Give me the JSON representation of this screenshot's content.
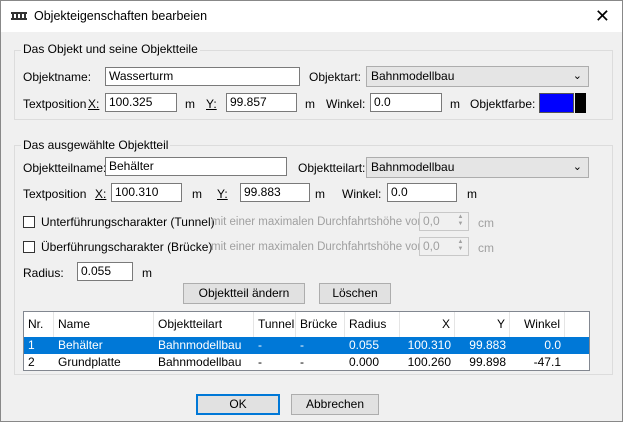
{
  "window": {
    "title": "Objekteigenschaften bearbeien",
    "close_glyph": "✕"
  },
  "object_group": {
    "title": "Das Objekt und seine Objektteile",
    "name_label": "Objektname:",
    "name_value": "Wasserturm",
    "type_label": "Objektart:",
    "type_value": "Bahnmodellbau",
    "textpos_label": "Textposition",
    "x_label": "X:",
    "x_value": "100.325",
    "x_unit": "m",
    "y_label": "Y:",
    "y_value": "99.857",
    "y_unit": "m",
    "angle_label": "Winkel:",
    "angle_value": "0.0",
    "angle_unit": "m",
    "color_label": "Objektfarbe:",
    "color": "#0000ff"
  },
  "part_group": {
    "title": "Das ausgewählte Objektteil",
    "name_label": "Objektteilname:",
    "name_value": "Behälter",
    "type_label": "Objektteilart:",
    "type_value": "Bahnmodellbau",
    "textpos_label": "Textposition",
    "x_label": "X:",
    "x_value": "100.310",
    "x_unit": "m",
    "y_label": "Y:",
    "y_value": "99.883",
    "y_unit": "m",
    "angle_label": "Winkel:",
    "angle_value": "0.0",
    "angle_unit": "m",
    "tunnel_label": "Unterführungscharakter (Tunnel)",
    "tunnel_hint": "mit einer maximalen Durchfahrtshöhe von:",
    "tunnel_value": "0,0",
    "tunnel_unit": "cm",
    "bridge_label": "Überführungscharakter (Brücke)",
    "bridge_hint": "mit einer maximalen Durchfahrtshöhe von:",
    "bridge_value": "0,0",
    "bridge_unit": "cm",
    "radius_label": "Radius:",
    "radius_value": "0.055",
    "radius_unit": "m",
    "change_button": "Objektteil ändern",
    "delete_button": "Löschen"
  },
  "table": {
    "columns": [
      "Nr.",
      "Name",
      "Objektteilart",
      "Tunnel",
      "Brücke",
      "Radius",
      "X",
      "Y",
      "Winkel"
    ],
    "rows": [
      [
        "1",
        "Behälter",
        "Bahnmodellbau",
        "-",
        "-",
        "0.055",
        "100.310",
        "99.883",
        "0.0"
      ],
      [
        "2",
        "Grundplatte",
        "Bahnmodellbau",
        "-",
        "-",
        "0.000",
        "100.260",
        "99.898",
        "-47.1"
      ]
    ],
    "selected_row": 0
  },
  "footer": {
    "ok": "OK",
    "cancel": "Abbrechen"
  }
}
